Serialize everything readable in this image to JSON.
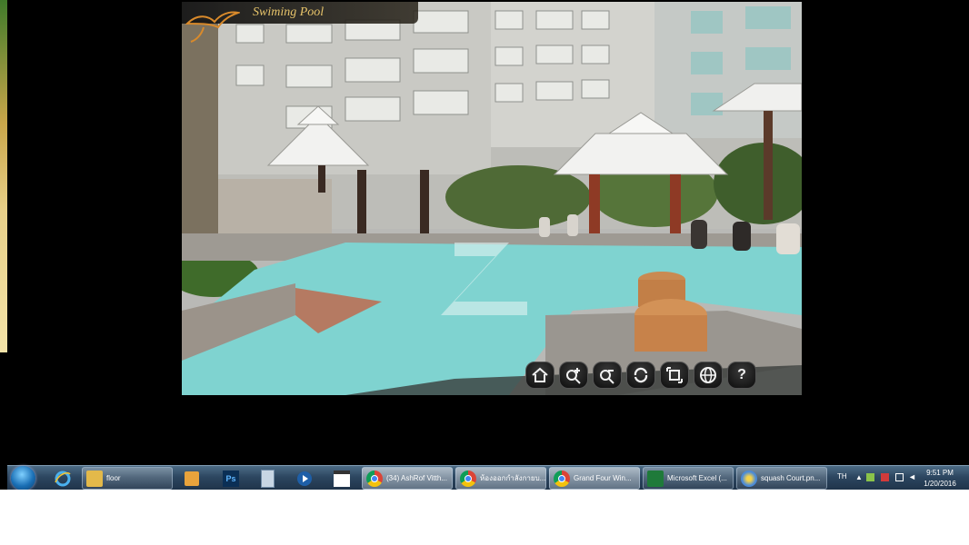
{
  "viewer": {
    "title": "Swiming Pool",
    "toolbar": [
      {
        "id": "home",
        "icon": "home-icon"
      },
      {
        "id": "zoom_in",
        "icon": "zoom-in-icon"
      },
      {
        "id": "zoom_out",
        "icon": "zoom-out-icon"
      },
      {
        "id": "autorotate",
        "icon": "rotate-icon"
      },
      {
        "id": "fullscreen",
        "icon": "fullscreen-icon"
      },
      {
        "id": "vr",
        "icon": "globe-icon"
      },
      {
        "id": "help",
        "icon": "help-icon",
        "label": "?"
      }
    ]
  },
  "taskbar": {
    "pinned_folder": "floor",
    "windows": [
      {
        "label": "(34) AshRof Vitth...",
        "icon": "chrome-icon"
      },
      {
        "label": "ห้องออกกำลังกายบ...",
        "icon": "chrome-icon"
      },
      {
        "label": "Grand Four Win...",
        "icon": "chrome-icon"
      },
      {
        "label": "Microsoft Excel (...",
        "icon": "excel-icon"
      },
      {
        "label": "squash Court.pn...",
        "icon": "paint-icon"
      }
    ],
    "tray": {
      "language": "TH",
      "time": "9:51 PM",
      "date": "1/20/2016"
    }
  }
}
